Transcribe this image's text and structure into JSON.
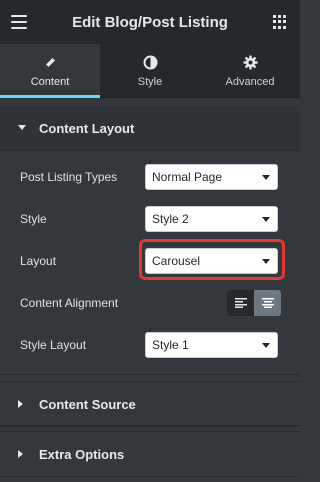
{
  "header": {
    "title": "Edit Blog/Post Listing",
    "menu_icon": "hamburger-icon",
    "apps_icon": "grid-icon"
  },
  "tabs": [
    {
      "label": "Content",
      "icon": "pencil-icon",
      "active": true
    },
    {
      "label": "Style",
      "icon": "half-circle-icon",
      "active": false
    },
    {
      "label": "Advanced",
      "icon": "gear-icon",
      "active": false
    }
  ],
  "content_layout": {
    "title": "Content Layout",
    "fields": {
      "post_listing_types": {
        "label": "Post Listing Types",
        "value": "Normal Page"
      },
      "style": {
        "label": "Style",
        "value": "Style 2"
      },
      "layout": {
        "label": "Layout",
        "value": "Carousel"
      },
      "content_alignment": {
        "label": "Content Alignment",
        "selected": "center"
      },
      "style_layout": {
        "label": "Style Layout",
        "value": "Style 1"
      }
    }
  },
  "sections": {
    "content_source": "Content Source",
    "extra_options": "Extra Options"
  },
  "colors": {
    "accent": "#71d7f7",
    "highlight": "#e53935",
    "panel_bg": "#34383c",
    "header_bg": "#26292c"
  }
}
